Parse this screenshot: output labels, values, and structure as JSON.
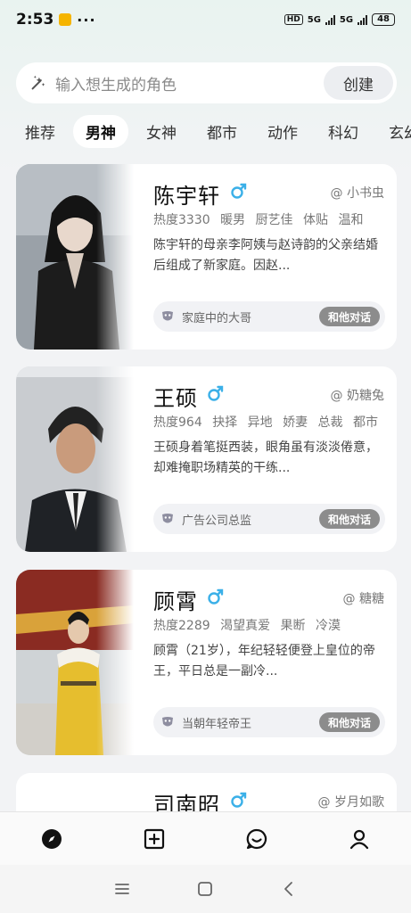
{
  "status": {
    "time": "2:53",
    "dots": "···",
    "hd": "HD",
    "net1": "5G",
    "net2": "5G",
    "battery": "48"
  },
  "search": {
    "placeholder": "输入想生成的角色",
    "create_label": "创建"
  },
  "tabs": [
    "推荐",
    "男神",
    "女神",
    "都市",
    "动作",
    "科幻",
    "玄幻"
  ],
  "active_tab": "男神",
  "cards": [
    {
      "name": "陈宇轩",
      "author": "@ 小书虫",
      "heat": "热度3330",
      "tags": [
        "暖男",
        "厨艺佳",
        "体贴",
        "温和"
      ],
      "desc": "陈宇轩的母亲李阿姨与赵诗韵的父亲结婚后组成了新家庭。因赵...",
      "role": "家庭中的大哥",
      "chat_label": "和他对话"
    },
    {
      "name": "王硕",
      "author": "@ 奶糖兔",
      "heat": "热度964",
      "tags": [
        "抉择",
        "异地",
        "娇妻",
        "总裁",
        "都市"
      ],
      "desc": "王硕身着笔挺西装，眼角虽有淡淡倦意，却难掩职场精英的干练...",
      "role": "广告公司总监",
      "chat_label": "和他对话"
    },
    {
      "name": "顾霄",
      "author": "@ 糖糖",
      "heat": "热度2289",
      "tags": [
        "渴望真爱",
        "果断",
        "冷漠"
      ],
      "desc": "顾霄（21岁），年纪轻轻便登上皇位的帝王，平日总是一副冷...",
      "role": "当朝年轻帝王",
      "chat_label": "和他对话"
    },
    {
      "name": "司南昭",
      "author": "@ 岁月如歌"
    }
  ],
  "colors": {
    "accent_male": "#3bb0e8",
    "chat_button": "#8c8c8c"
  },
  "nav_icons": [
    "compass-icon",
    "plus-square-icon",
    "chat-bubble-icon",
    "profile-icon"
  ]
}
